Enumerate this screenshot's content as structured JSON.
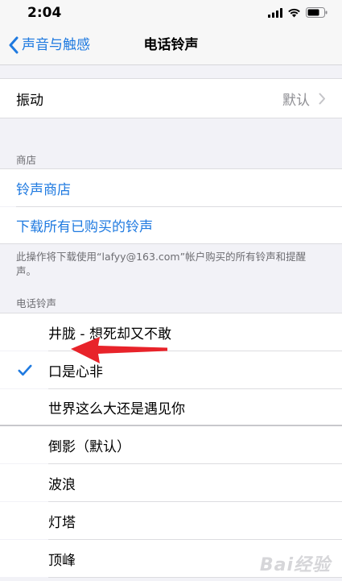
{
  "status_bar": {
    "time": "2:04"
  },
  "nav": {
    "back_label": "声音与触感",
    "title": "电话铃声"
  },
  "vibration": {
    "label": "振动",
    "value": "默认"
  },
  "store": {
    "header": "商店",
    "tone_store": "铃声商店",
    "download_all": "下载所有已购买的铃声",
    "footnote": "此操作将下载使用“lafyy@163.com”帐户购买的所有铃声和提醒声。"
  },
  "ringtones": {
    "header": "电话铃声",
    "custom": [
      {
        "label": "井胧 - 想死却又不敢",
        "selected": false
      },
      {
        "label": "口是心非",
        "selected": true
      },
      {
        "label": "世界这么大还是遇见你",
        "selected": false
      }
    ],
    "builtin": [
      {
        "label": "倒影（默认）"
      },
      {
        "label": "波浪"
      },
      {
        "label": "灯塔"
      },
      {
        "label": "顶峰"
      }
    ]
  },
  "watermark": "Bai经验",
  "colors": {
    "accent": "#1f7ae0",
    "annotation": "#e8232a"
  }
}
